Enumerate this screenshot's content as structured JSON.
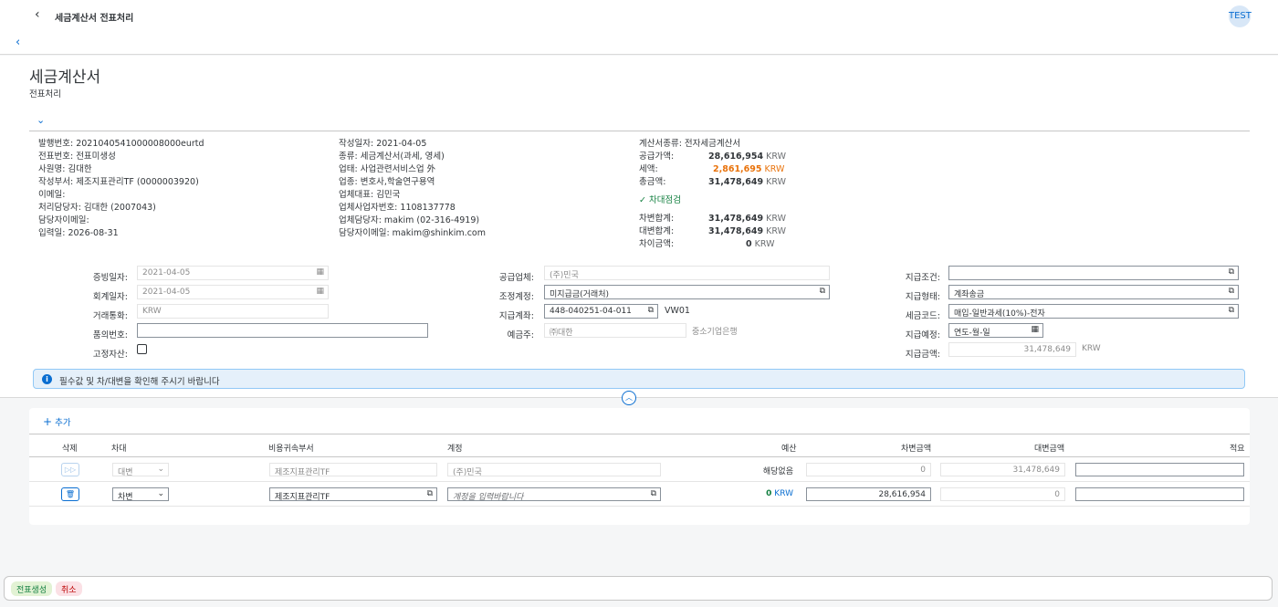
{
  "shell": {
    "title": "세금계산서 전표처리",
    "user": "TEST"
  },
  "header": {
    "title": "세금계산서",
    "subtitle": "전표처리"
  },
  "info_col1": [
    {
      "k": "발행번호: ",
      "v": "2021040541000008000eurtd"
    },
    {
      "k": "전표번호: ",
      "v": "전표미생성"
    },
    {
      "k": "사원명: ",
      "v": "김대한"
    },
    {
      "k": "작성부서: ",
      "v": "제조지표관리TF (0000003920)"
    },
    {
      "k": "이메일: ",
      "v": ""
    },
    {
      "k": "처리담당자: ",
      "v": "김대한 (2007043)"
    },
    {
      "k": "담당자이메일: ",
      "v": ""
    },
    {
      "k": "입력일: ",
      "v": "2026-08-31"
    }
  ],
  "info_col2": [
    {
      "k": "작성일자: ",
      "v": "2021-04-05"
    },
    {
      "k": "종류: ",
      "v": "세금계산서(과세, 영세)"
    },
    {
      "k": "업태: ",
      "v": "사업관련서비스업 外"
    },
    {
      "k": "업종: ",
      "v": "변호사,학술연구용역"
    },
    {
      "k": "업체대표: ",
      "v": "김민국"
    },
    {
      "k": "업체사업자번호: ",
      "v": "1108137778"
    },
    {
      "k": "업체담당자: ",
      "v": "makim (02-316-4919)"
    },
    {
      "k": "담당자이메일: ",
      "v": "makim@shinkim.com"
    }
  ],
  "info_col3": {
    "type_k": "계산서종류: ",
    "type_v": "전자세금계산서",
    "supply_k": "공급가액:",
    "supply_v": "28,616,954",
    "tax_k": "세액:",
    "tax_v": "2,861,695",
    "total_k": "총금액:",
    "total_v": "31,478,649",
    "check": "차대점검",
    "debit_k": "차변합계:",
    "debit_v": "31,478,649",
    "credit_k": "대변합계:",
    "credit_v": "31,478,649",
    "diff_k": "차이금액:",
    "diff_v": "0",
    "currency": "KRW"
  },
  "form": {
    "evidence_date_l": "증빙일자:",
    "evidence_date": "2021-04-05",
    "account_date_l": "회계일자:",
    "account_date": "2021-04-05",
    "currency_l": "거래통화:",
    "currency": "KRW",
    "approval_l": "품의번호:",
    "approval": "",
    "fixed_asset_l": "고정자산:",
    "supplier_l": "공급업체:",
    "supplier": "(주)민국",
    "adj_account_l": "조정계정:",
    "adj_account": "미지급금(거래처)",
    "pay_account_l": "지급계좌:",
    "pay_account": "448-040251-04-011",
    "pay_account_code": "VW01",
    "depositor_l": "예금주:",
    "depositor": "㈜대한",
    "bank": "중소기업은행",
    "pay_cond_l": "지급조건:",
    "pay_cond": "",
    "pay_type_l": "지급형태:",
    "pay_type": "계좌송금",
    "tax_code_l": "세금코드:",
    "tax_code": "매입-일반과세(10%)-전자",
    "pay_date_l": "지급예정:",
    "pay_date": "연도-월-일",
    "pay_amount_l": "지급금액:",
    "pay_amount": "31,478,649",
    "pay_amount_cur": "KRW"
  },
  "message": "필수값 및 차/대변을 확인해 주시기 바랍니다",
  "table": {
    "add_label": "추가",
    "columns": [
      "삭제",
      "차대",
      "비용귀속부서",
      "계정",
      "예산",
      "차변금액",
      "대변금액",
      "적요"
    ],
    "rows": [
      {
        "dc": "대변",
        "dept": "제조지표관리TF",
        "account": "(주)민국",
        "budget": "해당없음",
        "debit": "0",
        "credit": "31,478,649",
        "memo": ""
      },
      {
        "dc": "차변",
        "dept": "제조지표관리TF",
        "account": "계정을 입력바랍니다",
        "budget_val": "0",
        "budget_cur": "KRW",
        "debit": "28,616,954",
        "credit": "0",
        "memo": ""
      }
    ]
  },
  "footer": {
    "create": "전표생성",
    "cancel": "취소"
  },
  "colors": {
    "accent": "#0a6ed1",
    "positive": "#107e3e",
    "critical": "#e9730c"
  }
}
